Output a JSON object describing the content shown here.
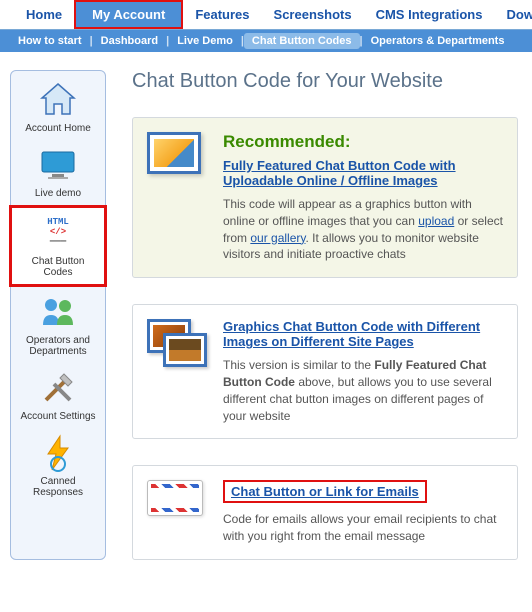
{
  "topnav": [
    "Home",
    "My Account",
    "Features",
    "Screenshots",
    "CMS Integrations",
    "Dow"
  ],
  "topnav_active": 1,
  "subnav": [
    "How to start",
    "Dashboard",
    "Live Demo",
    "Chat Button Codes",
    "Operators & Departments"
  ],
  "subnav_active": 3,
  "sidebar": {
    "items": [
      {
        "label": "Account Home",
        "icon": "home-icon"
      },
      {
        "label": "Live demo",
        "icon": "monitor-icon"
      },
      {
        "label": "Chat Button Codes",
        "icon": "html-code-icon"
      },
      {
        "label": "Operators and Departments",
        "icon": "users-icon"
      },
      {
        "label": "Account Settings",
        "icon": "tools-icon"
      },
      {
        "label": "Canned Responses",
        "icon": "lightning-icon"
      }
    ],
    "selected": 2
  },
  "main": {
    "title": "Chat Button Code for Your Website",
    "cards": [
      {
        "recommended": "Recommended:",
        "link": "Fully Featured Chat Button Code with Uploadable Online / Offline Images",
        "desc_before": "This code will appear as a graphics button with online or offline images that you can ",
        "link_upload": "upload",
        "desc_mid": " or select from ",
        "link_gallery": "our gallery",
        "desc_after": ". It allows you to monitor website visitors and initiate proactive chats"
      },
      {
        "link": "Graphics Chat Button Code with Different Images on Different Site Pages",
        "desc_before": "This version is similar to the ",
        "bold": "Fully Featured Chat Button Code",
        "desc_after": " above, but allows you to use several different chat button images on different pages of your website"
      },
      {
        "link": "Chat Button or Link for Emails",
        "desc": "Code for emails allows your email recipients to chat with you right from the email message"
      }
    ]
  }
}
